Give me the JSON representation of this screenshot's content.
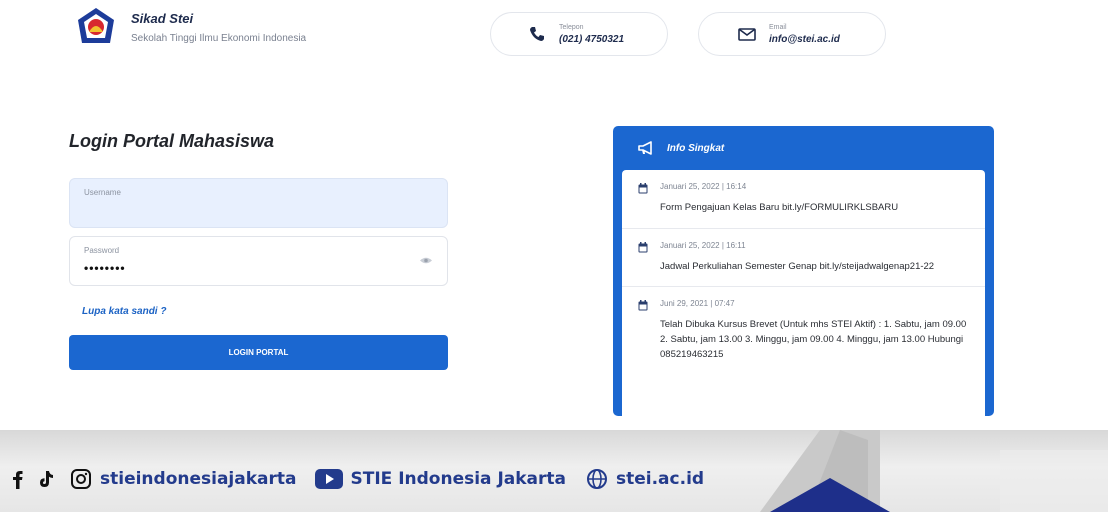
{
  "header": {
    "brand_title": "Sikad Stei",
    "brand_subtitle": "Sekolah Tinggi Ilmu Ekonomi Indonesia",
    "phone_label": "Telepon",
    "phone_value": "(021) 4750321",
    "email_label": "Email",
    "email_value": "info@stei.ac.id"
  },
  "login": {
    "title": "Login Portal Mahasiswa",
    "username_label": "Username",
    "username_value": "",
    "password_label": "Password",
    "password_value": "••••••••",
    "forgot_link": "Lupa kata sandi ?",
    "submit_label": "LOGIN PORTAL"
  },
  "info": {
    "title": "Info Singkat",
    "items": [
      {
        "date": "Januari 25, 2022 | 16:14",
        "text": "Form Pengajuan Kelas Baru bit.ly/FORMULIRKLSBARU"
      },
      {
        "date": "Januari 25, 2022 | 16:11",
        "text": "Jadwal Perkuliahan Semester Genap bit.ly/steijadwalgenap21-22"
      },
      {
        "date": "Juni 29, 2021 | 07:47",
        "text": "Telah Dibuka Kursus Brevet (Untuk mhs STEI Aktif) : 1. Sabtu, jam 09.00 2. Sabtu, jam 13.00 3. Minggu, jam 09.00 4. Minggu, jam 13.00 Hubungi 085219463215"
      }
    ]
  },
  "footer": {
    "social_handle": "stieindonesiajakarta",
    "youtube_channel": "STIE Indonesia Jakarta",
    "website": "stei.ac.id"
  },
  "colors": {
    "primary": "#1b67d0",
    "brand_dark": "#1e2b4d",
    "footer_text": "#233b8c"
  }
}
